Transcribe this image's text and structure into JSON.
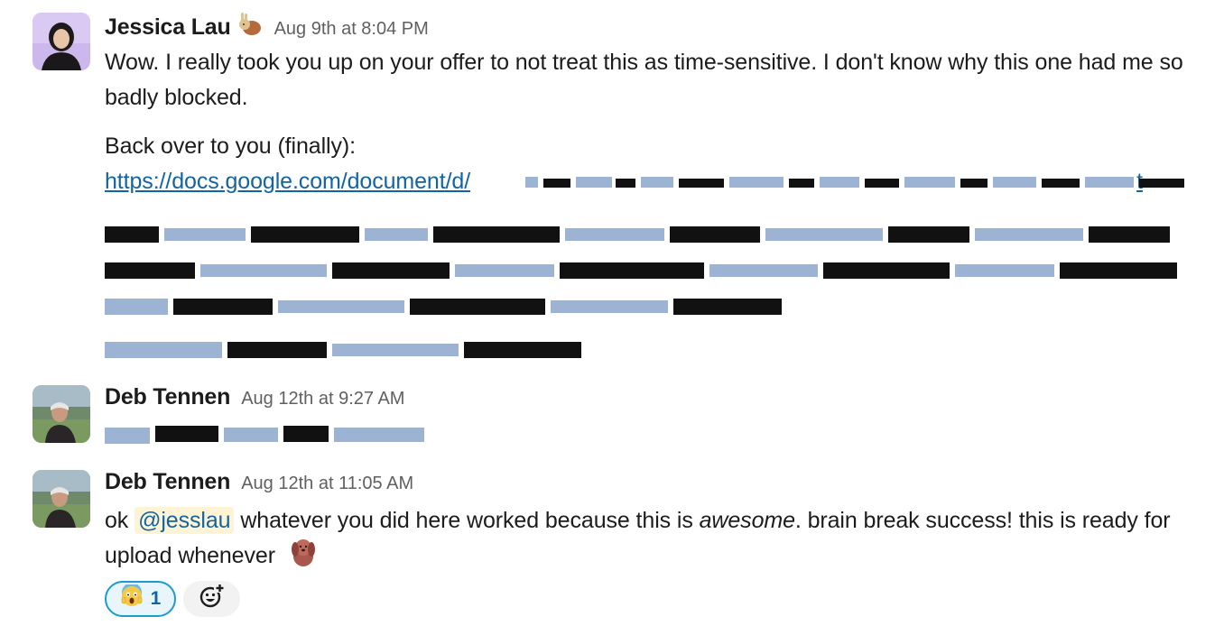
{
  "colors": {
    "link": "#1264a3",
    "mention_bg": "#fdf4d6",
    "reaction_border": "#1d9bd1",
    "redact_blue": "#9db3d3",
    "timestamp": "#616061"
  },
  "messages": [
    {
      "author": "Jessica Lau",
      "status_emoji": "rabbit-icon",
      "timestamp": "Aug 9th at 8:04 PM",
      "line1": "Wow. I really took you up on your offer to not treat this as time-sensitive. I don't know why this one had me so badly blocked.",
      "line2": "Back over to you (finally):",
      "link_visible": "https://docs.google.com/document/d/",
      "link_tail": "t"
    },
    {
      "author": "Deb Tennen",
      "timestamp": "Aug 12th at 9:27 AM"
    },
    {
      "author": "Deb Tennen",
      "timestamp": "Aug 12th at 11:05 AM",
      "text_prefix": "ok ",
      "mention": "@jesslau",
      "text_mid": " whatever you did here worked because this is ",
      "text_em": "awesome",
      "text_end": ". brain break success! this is ready for upload whenever",
      "trailing_emoji": "dog-icon",
      "reactions": [
        {
          "emoji": "scream-icon",
          "count": "1"
        },
        {
          "emoji": "add-reaction-icon"
        }
      ]
    }
  ]
}
